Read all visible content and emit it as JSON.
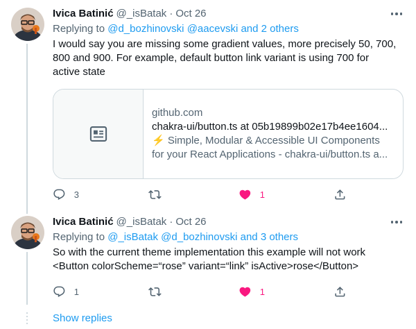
{
  "tweets": [
    {
      "display_name": "Ivica Batinić",
      "handle": "@_isBatak",
      "separator": "·",
      "date": "Oct 26",
      "replying_prefix": "Replying to ",
      "replying_to": [
        "@d_bozhinovski",
        "@aacevski"
      ],
      "replying_others": "and 2 others",
      "body_lines": [
        "I would say you are missing some gradient values, more precisely 50, 700,",
        "800 and 900. For example, default button link variant is using 700 for",
        "active state"
      ],
      "card": {
        "domain": "github.com",
        "title": "chakra-ui/button.ts at 05b19899b02e17b4ee1604...",
        "description_line1": "⚡️ Simple, Modular & Accessible UI Components",
        "description_line2": "for your React Applications - chakra-ui/button.ts a...",
        "thumb_icon": "article-icon"
      },
      "actions": {
        "reply_count": "3",
        "retweet_count": "",
        "like_count": "1",
        "liked": true
      }
    },
    {
      "display_name": "Ivica Batinić",
      "handle": "@_isBatak",
      "separator": "·",
      "date": "Oct 26",
      "replying_prefix": "Replying to ",
      "replying_to": [
        "@_isBatak",
        "@d_bozhinovski"
      ],
      "replying_others": "and 3 others",
      "body_lines": [
        "So with the current theme implementation this example will not work",
        "<Button colorScheme=“rose” variant=“link” isActive>rose</Button>"
      ],
      "actions": {
        "reply_count": "1",
        "retweet_count": "",
        "like_count": "1",
        "liked": true
      }
    }
  ],
  "show_replies_label": "Show replies",
  "colors": {
    "link": "#1d9bf0",
    "secondary_text": "#536471",
    "like_active": "#f91880",
    "border": "#cfd9de"
  }
}
